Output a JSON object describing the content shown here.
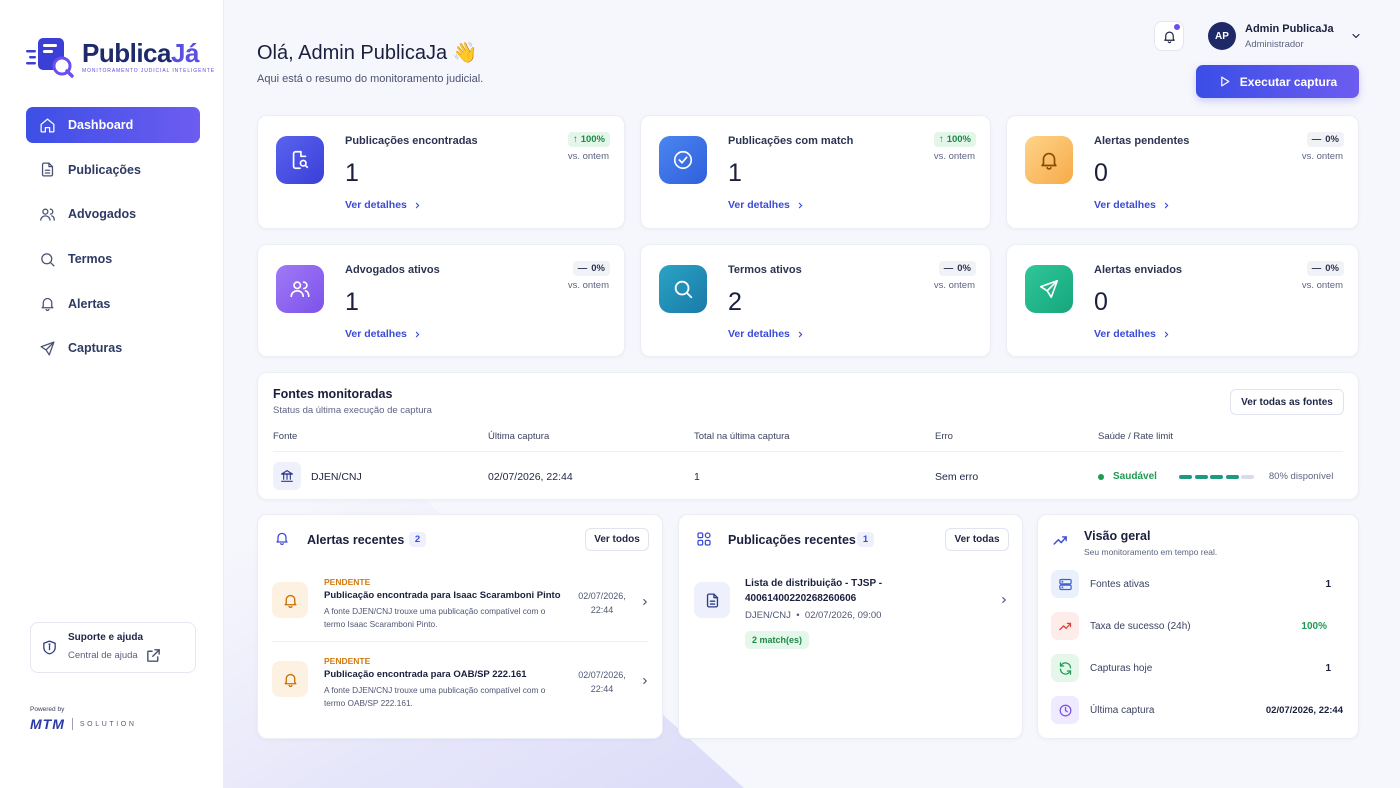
{
  "app": {
    "logo_name_part1": "Publica",
    "logo_name_part2": "Já",
    "logo_tagline": "MONITORAMENTO JUDICIAL INTELIGENTE"
  },
  "sidebar": {
    "items": [
      {
        "label": "Dashboard",
        "icon": "home-icon",
        "active": true
      },
      {
        "label": "Publicações",
        "icon": "document-icon"
      },
      {
        "label": "Advogados",
        "icon": "users-icon"
      },
      {
        "label": "Termos",
        "icon": "search-icon"
      },
      {
        "label": "Alertas",
        "icon": "bell-icon"
      },
      {
        "label": "Capturas",
        "icon": "send-icon"
      }
    ],
    "support_title": "Suporte e ajuda",
    "support_link": "Central de ajuda",
    "powered_by": "Powered by",
    "brand_mtm": "MTM",
    "brand_solution": "SOLUTION"
  },
  "header": {
    "greeting": "Olá, Admin PublicaJa 👋",
    "subtitle": "Aqui está o resumo do monitoramento judicial.",
    "user_initials": "AP",
    "user_name": "Admin PublicaJa",
    "user_role": "Administrador",
    "execute_button": "Executar captura"
  },
  "stats": [
    {
      "label": "Publicações encontradas",
      "value": "1",
      "delta": "100%",
      "delta_dir": "up",
      "vs": "vs. ontem",
      "link": "Ver detalhes",
      "icon": "document-search-icon",
      "color": "#4550e6"
    },
    {
      "label": "Publicações com match",
      "value": "1",
      "delta": "100%",
      "delta_dir": "up",
      "vs": "vs. ontem",
      "link": "Ver detalhes",
      "icon": "check-circle-icon",
      "color": "#3b6fe8"
    },
    {
      "label": "Alertas pendentes",
      "value": "0",
      "delta": "0%",
      "delta_dir": "flat",
      "vs": "vs. ontem",
      "link": "Ver detalhes",
      "icon": "bell-icon",
      "color": "#f6b04a"
    },
    {
      "label": "Advogados ativos",
      "value": "1",
      "delta": "0%",
      "delta_dir": "flat",
      "vs": "vs. ontem",
      "link": "Ver detalhes",
      "icon": "users-icon",
      "color": "#8a5cf0"
    },
    {
      "label": "Termos ativos",
      "value": "2",
      "delta": "0%",
      "delta_dir": "flat",
      "vs": "vs. ontem",
      "link": "Ver detalhes",
      "icon": "search-icon",
      "color": "#1f8fb8"
    },
    {
      "label": "Alertas enviados",
      "value": "0",
      "delta": "0%",
      "delta_dir": "flat",
      "vs": "vs. ontem",
      "link": "Ver detalhes",
      "icon": "send-icon",
      "color": "#1fb38a"
    }
  ],
  "fontes": {
    "title": "Fontes monitoradas",
    "subtitle": "Status da última execução de captura",
    "button": "Ver todas as fontes",
    "columns": [
      "Fonte",
      "Última captura",
      "Total na última captura",
      "Erro",
      "Saúde / Rate limit"
    ],
    "rows": [
      {
        "fonte": "DJEN/CNJ",
        "ultima": "02/07/2026, 22:44",
        "total": "1",
        "erro": "Sem erro",
        "saude": "Saudável",
        "rate_available": 0.8,
        "rate_label": "80% disponível"
      }
    ]
  },
  "alertas": {
    "title": "Alertas recentes",
    "count": "2",
    "button": "Ver todos",
    "items": [
      {
        "status": "PENDENTE",
        "title": "Publicação encontrada para Isaac Scaramboni Pinto",
        "desc": "A fonte DJEN/CNJ trouxe uma publicação compatível com o termo Isaac Scaramboni Pinto.",
        "date": "02/07/2026,",
        "time": "22:44"
      },
      {
        "status": "PENDENTE",
        "title": "Publicação encontrada para OAB/SP 222.161",
        "desc": "A fonte DJEN/CNJ trouxe uma publicação compatível com o termo OAB/SP 222.161.",
        "date": "02/07/2026,",
        "time": "22:44"
      }
    ]
  },
  "publicacoes": {
    "title": "Publicações recentes",
    "count": "1",
    "button": "Ver todas",
    "items": [
      {
        "title": "Lista de distribuição - TJSP - 40061400220268260606",
        "source": "DJEN/CNJ",
        "sep": "•",
        "datetime": "02/07/2026, 09:00",
        "match": "2 match(es)"
      }
    ]
  },
  "visao": {
    "title": "Visão geral",
    "subtitle": "Seu monitoramento em tempo real.",
    "rows": [
      {
        "label": "Fontes ativas",
        "value": "1",
        "icon": "server-icon",
        "color": "#3a5fd6",
        "bg": "#eaf0fc"
      },
      {
        "label": "Taxa de sucesso (24h)",
        "value": "100%",
        "icon": "trend-up-icon",
        "color": "#d9443a",
        "bg": "#fdecea",
        "green": true
      },
      {
        "label": "Capturas hoje",
        "value": "1",
        "icon": "refresh-icon",
        "color": "#1e9a52",
        "bg": "#e5f6eb"
      },
      {
        "label": "Última captura",
        "value": "02/07/2026, 22:44",
        "icon": "clock-icon",
        "color": "#7b52e8",
        "bg": "#efeafd"
      }
    ]
  }
}
